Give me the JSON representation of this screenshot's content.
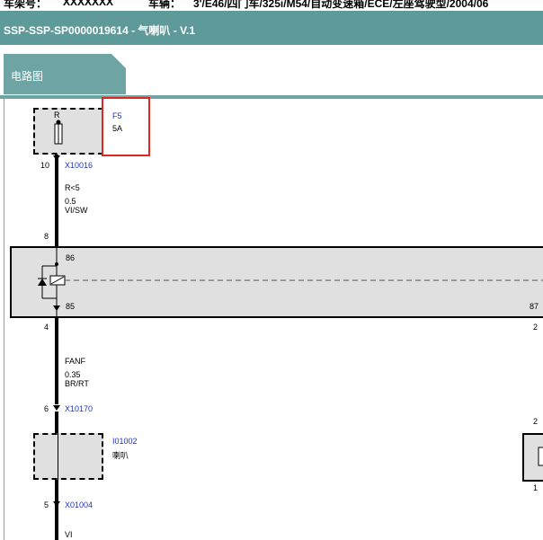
{
  "top_info": {
    "chassis_label": "车架号：",
    "chassis_value": "XXXXXXX",
    "vehicle_label": "车辆：",
    "vehicle_value": "3'/E46/四门车/325i/M54/自动变速箱/ECE/左座驾驶型/2004/06"
  },
  "title": "SSP-SSP-SP0000019614 - 气喇叭 - V.1",
  "tab": {
    "label": "电路图"
  },
  "diagram": {
    "fuse": {
      "pin": "R",
      "id": "F5",
      "rating": "5A",
      "pin_below": "10",
      "connector": "X10016"
    },
    "wire1": {
      "code": "R<5",
      "size": "0.5",
      "color": "VI/SW"
    },
    "relay": {
      "pin_top": "8",
      "pin_86": "86",
      "pin_85": "85",
      "pin_87": "87",
      "pin_bottom": "4",
      "pin_right_bottom": "2"
    },
    "wire2": {
      "code": "FANF",
      "size": "0.35",
      "color": "BR/RT"
    },
    "connector2": {
      "pin": "6",
      "id": "X10170"
    },
    "component": {
      "id": "I01002",
      "name": "喇叭"
    },
    "connector3": {
      "pin": "5",
      "id": "X01004"
    },
    "wire3": {
      "color": "VI"
    },
    "right_component": {
      "pin_top": "2",
      "pin_bottom": "1"
    }
  }
}
